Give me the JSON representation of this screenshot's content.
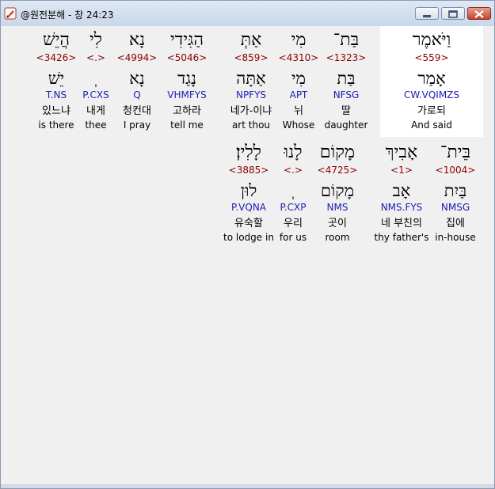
{
  "window": {
    "title": "@원전분해 - 창 24:23",
    "app_icon": "edit-pen-icon",
    "controls": [
      "minimize-icon",
      "maximize-icon",
      "close-icon"
    ]
  },
  "rows": [
    [
      {
        "heb": "וַיֹּאמֶר",
        "num": "<559>",
        "lex": "אָמַר",
        "parse": "CW.VQIMZS",
        "kor": "가로되",
        "eng": "And said",
        "highlight": true
      },
      {
        "heb": "בַּת־",
        "num": "<1323>",
        "lex": "בַּת",
        "parse": "NFSG",
        "kor": "딸",
        "eng": "daughter"
      },
      {
        "heb": "מִי",
        "num": "<4310>",
        "lex": "מִי",
        "parse": "APT",
        "kor": "뉘",
        "eng": "Whose"
      },
      {
        "heb": "אַתְּ",
        "num": "<859>",
        "lex": "אַתָּה",
        "parse": "NPFYS",
        "kor": "네가-이냐",
        "eng": "art thou"
      },
      {
        "heb": "הַגִּידִי",
        "num": "<5046>",
        "lex": "נָגַד",
        "parse": "VHMFYS",
        "kor": "고하라",
        "eng": "tell me"
      },
      {
        "heb": "נָא",
        "num": "<4994>",
        "lex": "נָא",
        "parse": "Q",
        "kor": "청컨대",
        "eng": "I pray"
      },
      {
        "heb": "לִי",
        "num": "<.>",
        "lex": "ְ",
        "parse": "P.CXS",
        "kor": "내게",
        "eng": "thee"
      },
      {
        "heb": "הֲיֵשׁ",
        "num": "<3426>",
        "lex": "יֵשׁ",
        "parse": "T.NS",
        "kor": "있느냐",
        "eng": "is there"
      }
    ],
    [
      {
        "heb": "בֵּית־",
        "num": "<1004>",
        "lex": "בַּיִת",
        "parse": "NMSG",
        "kor": "집에",
        "eng": "in-house"
      },
      {
        "heb": "אָבִיךְ",
        "num": "<1>",
        "lex": "אָב",
        "parse": "NMS.FYS",
        "kor": "네 부친의",
        "eng": "thy father's"
      },
      {
        "heb": "מָקוֹם",
        "num": "<4725>",
        "lex": "מָקוֹם",
        "parse": "NMS",
        "kor": "곳이",
        "eng": "room"
      },
      {
        "heb": "לָנוּ",
        "num": "<.>",
        "lex": "ְ",
        "parse": "P.CXP",
        "kor": "우리",
        "eng": "for us"
      },
      {
        "heb": "לָלִין׃",
        "num": "<3885>",
        "lex": "לוּן",
        "parse": "P.VQNA",
        "kor": "유숙할",
        "eng": "to lodge in"
      }
    ]
  ]
}
